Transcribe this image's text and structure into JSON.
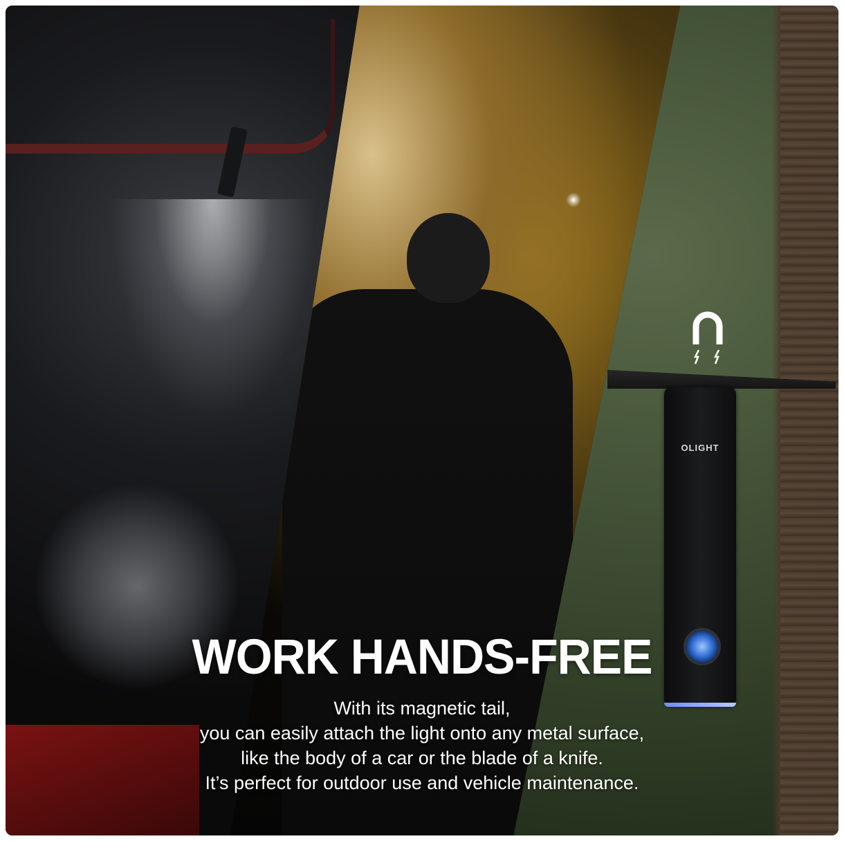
{
  "headline": "WORK HANDS-FREE",
  "body_lines": [
    "With its magnetic tail,",
    "you can easily attach the light onto any metal surface,",
    "like the body of a car or the blade of a knife.",
    "It’s perfect for outdoor use and vehicle maintenance."
  ],
  "device": {
    "brand_label": "OLIGHT"
  },
  "icons": {
    "magnet": "magnet-icon"
  },
  "colors": {
    "text": "#ffffff",
    "device_button": "#2e6bd1"
  }
}
